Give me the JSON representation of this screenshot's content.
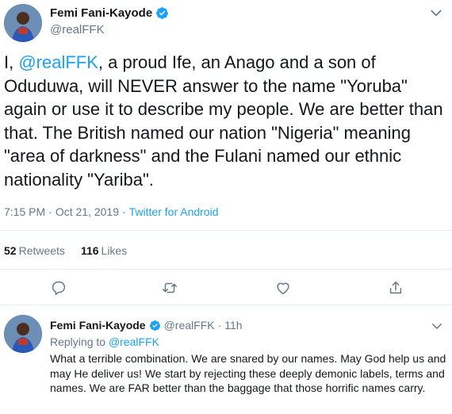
{
  "tweet": {
    "author_name": "Femi Fani-Kayode",
    "author_handle": "@realFFK",
    "text_prefix": "I, ",
    "text_mention": "@realFFK",
    "text_body": ", a proud Ife, an Anago and a son of Oduduwa, will NEVER answer to the name \"Yoruba\" again or use it to describe my people. We are better than that. The British named our nation \"Nigeria\" meaning \"area of darkness\" and the Fulani named our ethnic nationality \"Yariba\".",
    "time": "7:15 PM",
    "date": "Oct 21, 2019",
    "source": "Twitter for Android",
    "retweets_count": "52",
    "retweets_label": "Retweets",
    "likes_count": "116",
    "likes_label": "Likes"
  },
  "reply": {
    "author_name": "Femi Fani-Kayode",
    "author_handle": "@realFFK",
    "age": "11h",
    "replying_label": "Replying to",
    "replying_to": "@realFFK",
    "text": "What a terrible combination. We are snared by our names. May God help us and may He deliver us! We start by rejecting these deeply demonic labels, terms and names. We are FAR better than the baggage that those horrific names carry."
  },
  "icons": {
    "verified": "verified-badge-icon",
    "chevron": "chevron-down-icon",
    "reply": "reply-icon",
    "retweet": "retweet-icon",
    "like": "heart-icon",
    "share": "share-icon"
  },
  "colors": {
    "accent": "#1da1f2",
    "muted": "#657786",
    "text": "#14171a",
    "divider": "#e6ecf0"
  }
}
